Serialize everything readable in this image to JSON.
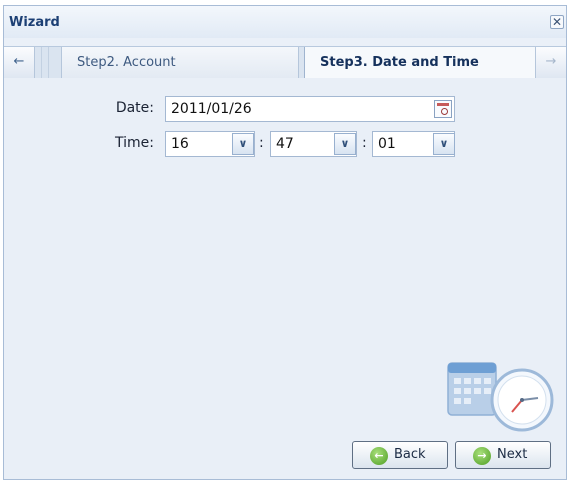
{
  "window": {
    "title": "Wizard",
    "close_glyph": "✕"
  },
  "tabs": {
    "prev_arrow": "←",
    "next_arrow": "→",
    "items": [
      {
        "label": "Step2. Account",
        "active": false
      },
      {
        "label": "Step3. Date and Time",
        "active": true
      }
    ]
  },
  "form": {
    "date_label": "Date:",
    "date_value": "2011/01/26",
    "time_label": "Time:",
    "hour": "16",
    "minute": "47",
    "second": "01",
    "separator": ":",
    "dropdown_glyph": "∨"
  },
  "buttons": {
    "back_label": "Back",
    "back_icon": "←",
    "next_label": "Next",
    "next_icon": "→"
  },
  "icons": {
    "calendar_picker": "calendar-icon",
    "decoration": "calendar-clock-icon"
  }
}
